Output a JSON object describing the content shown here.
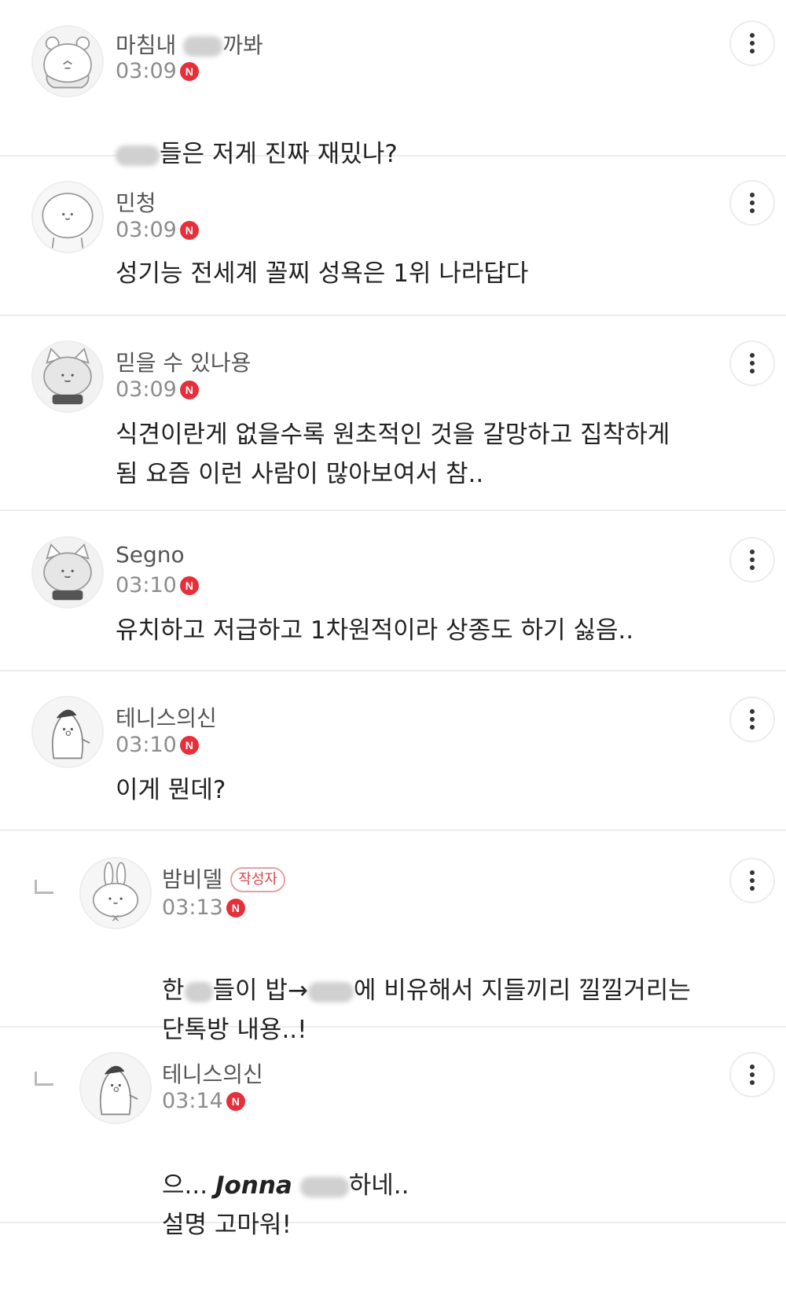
{
  "comments": [
    {
      "nickname": "마침내 죽을까봐",
      "nickname_visible_start": "마침내 ",
      "nickname_visible_end": "까봐",
      "time": "03:09",
      "new_badge": "N",
      "text_visible": "들은 저게 진짜 재밌나?"
    },
    {
      "nickname": "민청",
      "time": "03:09",
      "new_badge": "N",
      "text": "성기능 전세계 꼴찌 성욕은 1위 나라답다"
    },
    {
      "nickname": "믿을 수 있나용",
      "time": "03:09",
      "new_badge": "N",
      "text": "식견이란게 없을수록 원초적인 것을 갈망하고 집착하게\n됨 요즘 이런 사람이 많아보여서 참.."
    },
    {
      "nickname": "Segno",
      "time": "03:10",
      "new_badge": "N",
      "text": "유치하고 저급하고 1차원적이라 상종도 하기 싫음.."
    },
    {
      "nickname": "테니스의신",
      "time": "03:10",
      "new_badge": "N",
      "text": "이게 뭔데?"
    },
    {
      "nickname": "밤비델",
      "author_badge": "작성자",
      "time": "03:13",
      "new_badge": "N",
      "text_part1": "한",
      "text_part2": "들이 밥→",
      "text_part3": "에 비유해서 지들끼리 낄낄거리는",
      "text_line2": "단톡방 내용..!"
    },
    {
      "nickname": "테니스의신",
      "time": "03:14",
      "new_badge": "N",
      "text_part1": "으... ",
      "text_bold": "Jonna",
      "text_part2": "하네..",
      "text_line2": "설명 고마워!"
    }
  ]
}
